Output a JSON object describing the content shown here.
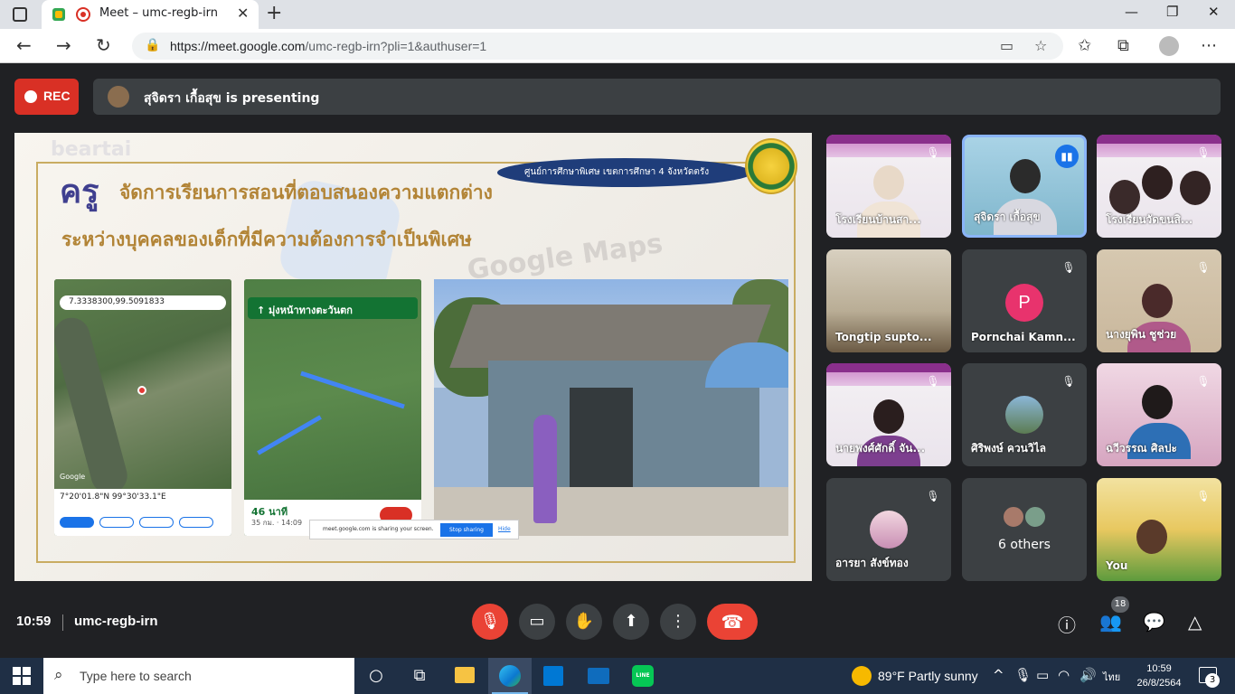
{
  "browser": {
    "tab_title": "Meet – umc-regb-irn",
    "tab_close": "✕",
    "new_tab": "+",
    "url_host": "https://meet.google.com",
    "url_path": "/umc-regb-irn?pli=1&authuser=1",
    "window_controls": [
      "—",
      "❐",
      "✕"
    ]
  },
  "meet": {
    "rec_label": "REC",
    "presenting_text": "สุจิดรา เกื้อสุข is presenting",
    "time": "10:59",
    "meeting_code": "umc-regb-irn",
    "participant_count": "18"
  },
  "slide": {
    "brand_watermark": "beartai",
    "maps_watermark": "Google Maps",
    "kru": "ครู",
    "title_line1": "จัดการเรียนการสอนที่ตอบสนองความแตกต่าง",
    "title_line2": "ระหว่างบุคคลของเด็กที่มีความต้องการจำเป็นพิเศษ",
    "badge": "ศูนย์การศึกษาพิเศษ เขตการศึกษา 4 จังหวัดตรัง",
    "phone1_search": "7.3338300,99.5091833",
    "phone1_coords": "7°20'01.8\"N 99°30'33.1\"E",
    "phone1_google": "Google",
    "phone2_banner": "↑   มุ่งหน้าทางตะวันตก",
    "phone2_eta": "46 นาที",
    "phone2_dist": "35 กม. · 14:09",
    "share_message": "meet.google.com is sharing your screen.",
    "share_stop": "Stop sharing",
    "share_hide": "Hide"
  },
  "participants": [
    {
      "name": "โรงเรียนบ้านสา...",
      "muted": true
    },
    {
      "name": "สุจิดรา เกื้อสุข",
      "muted": false,
      "speaking": true
    },
    {
      "name": "โรงเรียนวัดขนสิ...",
      "muted": true
    },
    {
      "name": "Tongtip supto...",
      "muted": false
    },
    {
      "name": "Pornchai Kamn...",
      "muted": true,
      "initial": "P"
    },
    {
      "name": "นางยุพิน ชูช่วย",
      "muted": true
    },
    {
      "name": "นายพงศ์ศักดิ์ จัน...",
      "muted": true
    },
    {
      "name": "ศิริพงษ์ ควนวิไล",
      "muted": true
    },
    {
      "name": "ฉวีวรรณ ศิลปะ",
      "muted": true
    },
    {
      "name": "อารยา สังข์ทอง",
      "muted": true
    },
    {
      "name": "6 others"
    },
    {
      "name": "You",
      "muted": true
    }
  ],
  "taskbar": {
    "search_placeholder": "Type here to search",
    "line_label": "LINE",
    "weather": "89°F  Partly sunny",
    "lang": "ไทย",
    "clock_time": "10:59",
    "clock_date": "26/8/2564",
    "notifications": "3"
  },
  "colors": {
    "meet_bg": "#202124",
    "tile_bg": "#3c4043",
    "rec_red": "#d93025",
    "end_red": "#ea4335",
    "taskbar": "#1f2f45"
  }
}
